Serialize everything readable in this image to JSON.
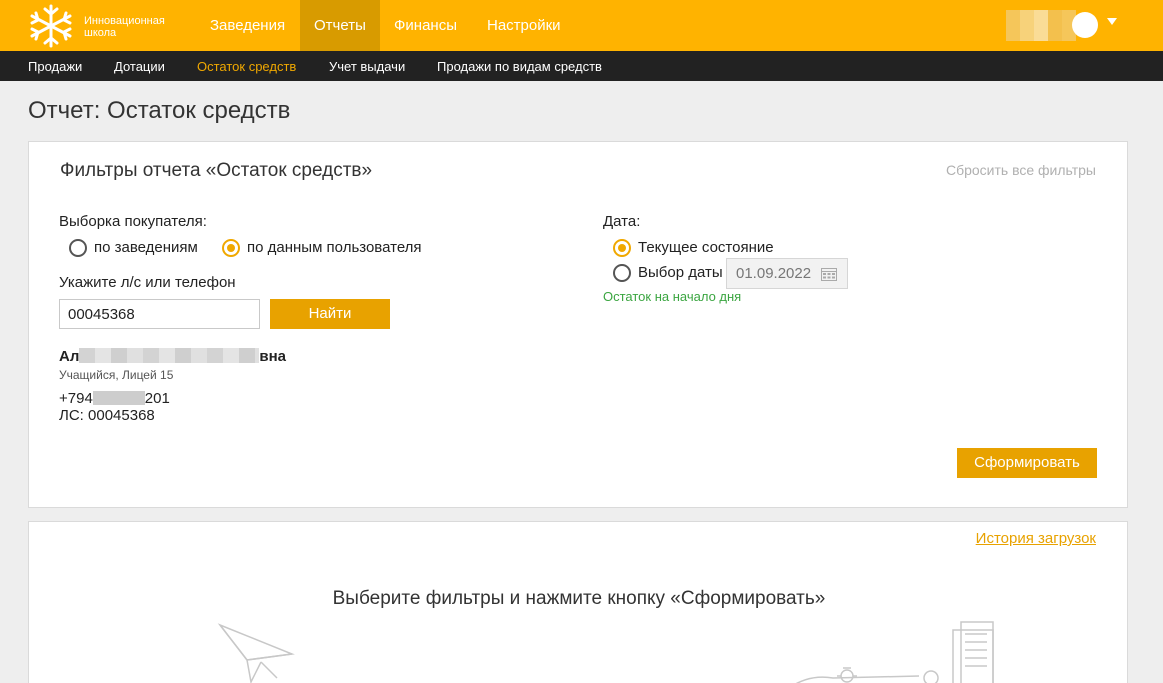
{
  "header": {
    "logo_line1": "Инновационная",
    "logo_line2": "школа",
    "nav": [
      "Заведения",
      "Отчеты",
      "Финансы",
      "Настройки"
    ],
    "active_nav": "Отчеты"
  },
  "subnav": {
    "items": [
      "Продажи",
      "Дотации",
      "Остаток средств",
      "Учет выдачи",
      "Продажи по видам средств"
    ],
    "active": "Остаток средств"
  },
  "page_title": "Отчет: Остаток средств",
  "filters": {
    "title": "Фильтры отчета «Остаток средств»",
    "reset_label": "Сбросить все фильтры",
    "buyer_label": "Выборка покупателя:",
    "buyer_options": [
      "по заведениям",
      "по данным пользователя"
    ],
    "buyer_selected": "по данным пользователя",
    "search_label": "Укажите л/с или телефон",
    "search_value": "00045368",
    "find_button": "Найти",
    "date_label": "Дата:",
    "date_options": [
      "Текущее состояние",
      "Выбор даты"
    ],
    "date_selected": "Текущее состояние",
    "date_value": "01.09.2022",
    "date_hint": "Остаток на начало дня",
    "submit_button": "Сформировать"
  },
  "user": {
    "name_start": "Ал",
    "name_end": "вна",
    "subtitle": "Учащийся, Лицей 15",
    "phone_start": "+794",
    "phone_end": "201",
    "account": "ЛС: 00045368"
  },
  "results": {
    "history_link": "История загрузок",
    "empty_message": "Выберите фильтры и нажмите кнопку «Сформировать»"
  },
  "colors": {
    "brand": "#ffb300",
    "nav_active": "#d89b00",
    "accent": "#e8a200",
    "hint_green": "#3aa540"
  }
}
